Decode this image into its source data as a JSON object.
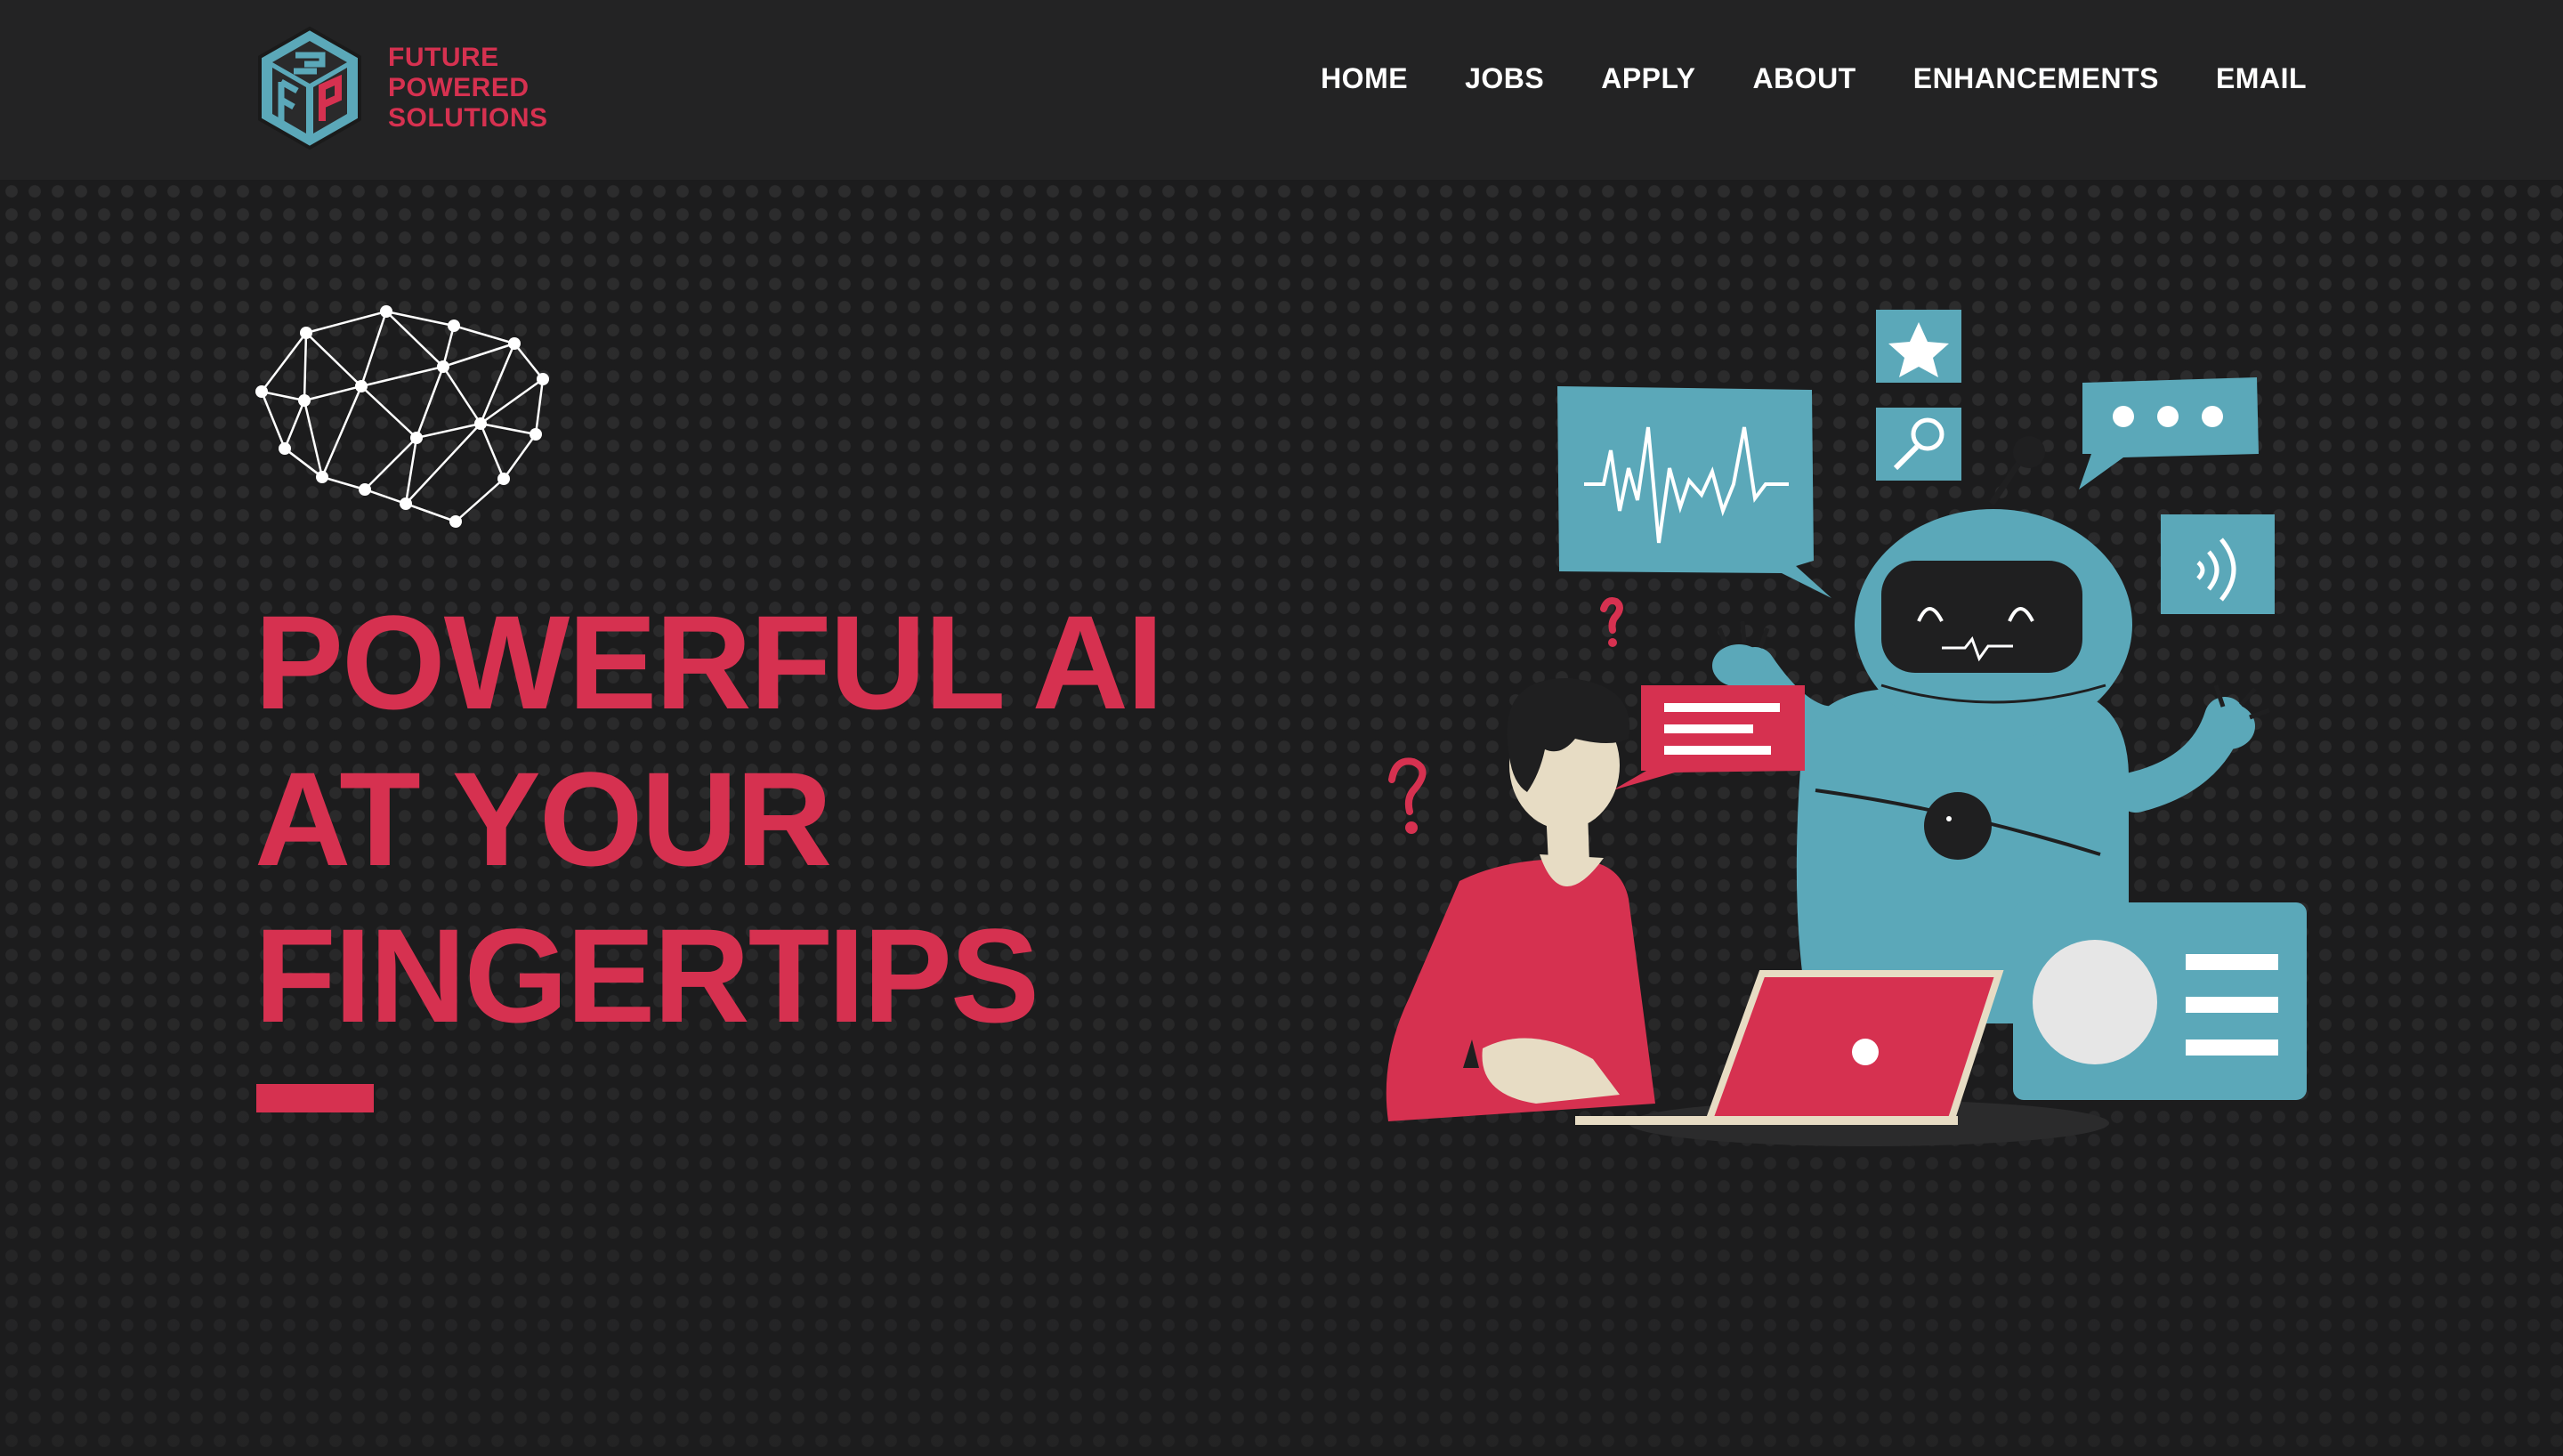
{
  "brand": {
    "name_lines": [
      "FUTURE",
      "POWERED",
      "SOLUTIONS"
    ],
    "logo_icon": "cube-fps-logo-icon",
    "colors": {
      "accent": "#d63150",
      "teal": "#5ba8b9",
      "background": "#1c1c1d",
      "header": "#232324"
    }
  },
  "nav": {
    "items": [
      {
        "label": "HOME"
      },
      {
        "label": "JOBS"
      },
      {
        "label": "APPLY"
      },
      {
        "label": "ABOUT"
      },
      {
        "label": "ENHANCEMENTS"
      },
      {
        "label": "EMAIL"
      }
    ]
  },
  "hero": {
    "headline_lines": [
      "POWERFUL AI",
      "AT YOUR",
      "FINGERTIPS"
    ],
    "brain_icon": "neural-brain-icon",
    "illustration": "person-with-laptop-and-robot-illustration"
  }
}
